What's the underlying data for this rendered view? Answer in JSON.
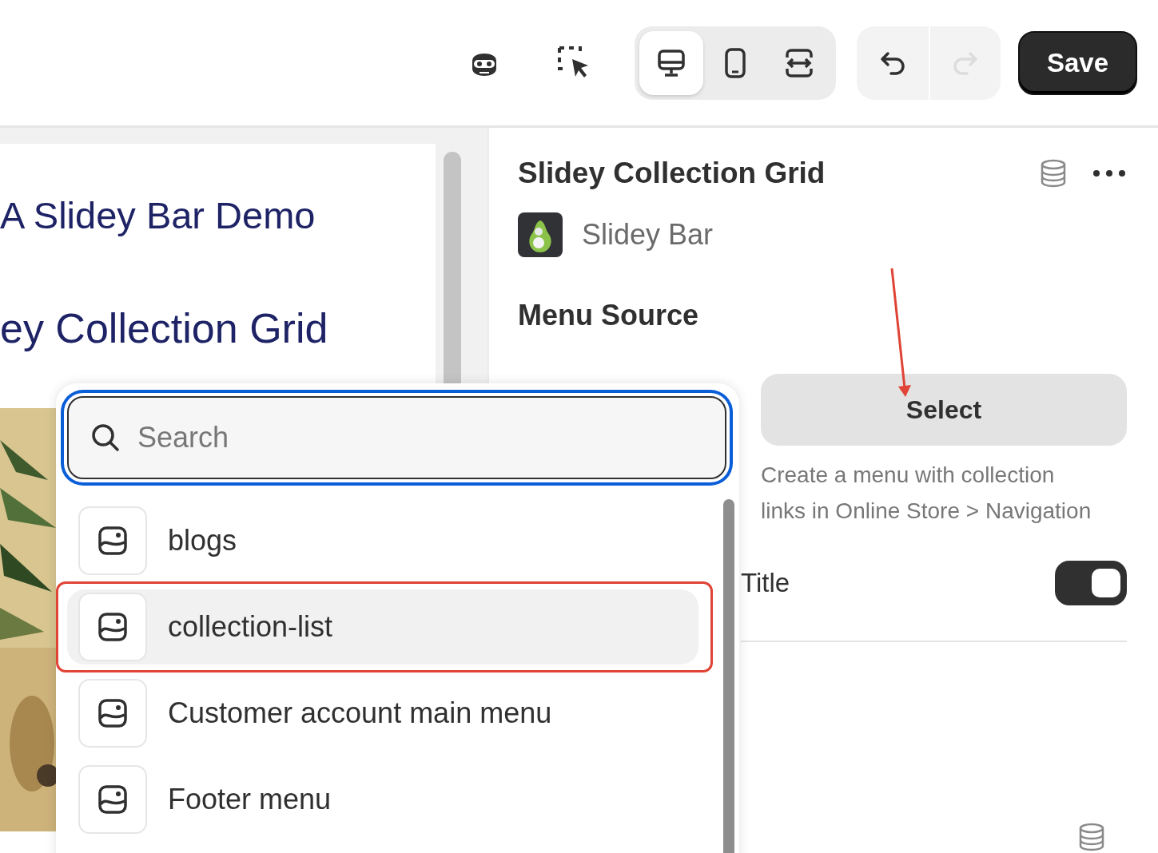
{
  "toolbar": {
    "view_modes": [
      {
        "kind": "desktop",
        "selected": true
      },
      {
        "kind": "mobile",
        "selected": false
      },
      {
        "kind": "fullwidth",
        "selected": false
      }
    ],
    "history": [
      {
        "kind": "undo",
        "disabled": false
      },
      {
        "kind": "redo",
        "disabled": true
      }
    ],
    "save_button": "Save"
  },
  "preview": {
    "headings": [
      "A Slidey Bar Demo",
      "ey Collection Grid"
    ],
    "hero": {
      "kind": "picture"
    }
  },
  "panel": {
    "title": "Slidey Collection Grid",
    "app_name": "Slidey Bar",
    "section_label": "Menu Source",
    "select_button": "Select",
    "help_text": "Create a menu with collection links in Online Store > Navigation",
    "settings": [
      {
        "label": "Title",
        "kind": "toggle",
        "on": true
      }
    ]
  },
  "dropdown": {
    "search": {
      "placeholder": "Search",
      "focused": true
    },
    "items": [
      {
        "label": "blogs",
        "selected": false
      },
      {
        "label": "collection-list",
        "selected": true
      },
      {
        "label": "Customer account main menu",
        "selected": false
      },
      {
        "label": "Footer menu",
        "selected": false
      }
    ]
  }
}
